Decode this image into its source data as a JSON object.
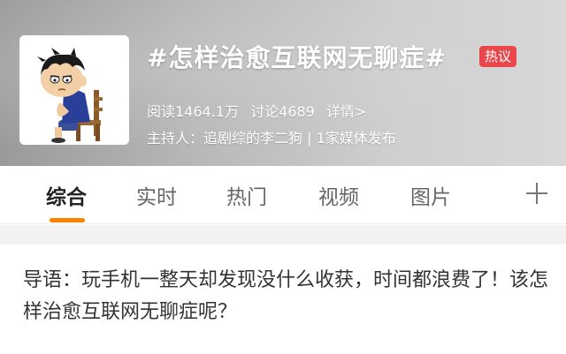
{
  "topic": {
    "title": "#怎样治愈互联网无聊症#",
    "badge": "热议",
    "badge_color": "#e8474b",
    "reads": "阅读1464.1万",
    "discussions": "讨论4689",
    "details_link": "详情>",
    "host": "主持人：追剧综的李二狗 | 1家媒体发布"
  },
  "tabs": [
    {
      "label": "综合",
      "active": true
    },
    {
      "label": "实时",
      "active": false
    },
    {
      "label": "热门",
      "active": false
    },
    {
      "label": "视频",
      "active": false
    },
    {
      "label": "图片",
      "active": false
    }
  ],
  "accent_color": "#ff8200",
  "more_tabs_icon": "plus-icon",
  "intro": {
    "text": "导语：玩手机一整天却发现没什么收获，时间都浪费了！该怎样治愈互联网无聊症呢？"
  }
}
